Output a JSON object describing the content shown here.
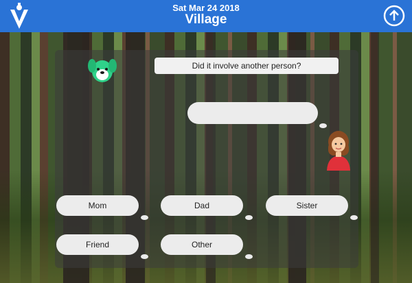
{
  "header": {
    "date": "Sat Mar 24 2018",
    "title": "Village",
    "logo_icon": "v-logo-icon",
    "upload_icon": "upload-icon"
  },
  "chat": {
    "question": "Did it involve another person?",
    "reply": ""
  },
  "options": [
    "Mom",
    "Dad",
    "Sister",
    "Friend",
    "Other"
  ],
  "colors": {
    "header": "#2a73d6",
    "bubble": "#ececec",
    "dog": "#2fd28a"
  }
}
